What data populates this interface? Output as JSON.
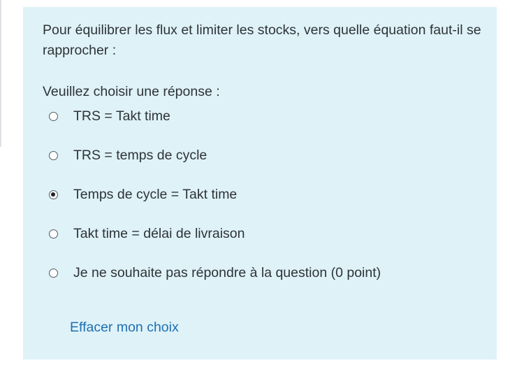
{
  "question": {
    "text": "Pour équilibrer les flux et limiter les stocks, vers quelle équation faut-il se rapprocher :",
    "prompt": "Veuillez choisir une réponse :",
    "answers": [
      {
        "label": "TRS = Takt time",
        "selected": false
      },
      {
        "label": "TRS = temps de cycle",
        "selected": false
      },
      {
        "label": "Temps de cycle = Takt time",
        "selected": true
      },
      {
        "label": "Takt time = délai de livraison",
        "selected": false
      },
      {
        "label": "Je ne souhaite pas répondre à la question (0 point)",
        "selected": false
      }
    ],
    "clear_label": "Effacer mon choix"
  },
  "colors": {
    "panel_background": "#def2f8",
    "link": "#1f6fb2",
    "text": "#2f3337"
  }
}
